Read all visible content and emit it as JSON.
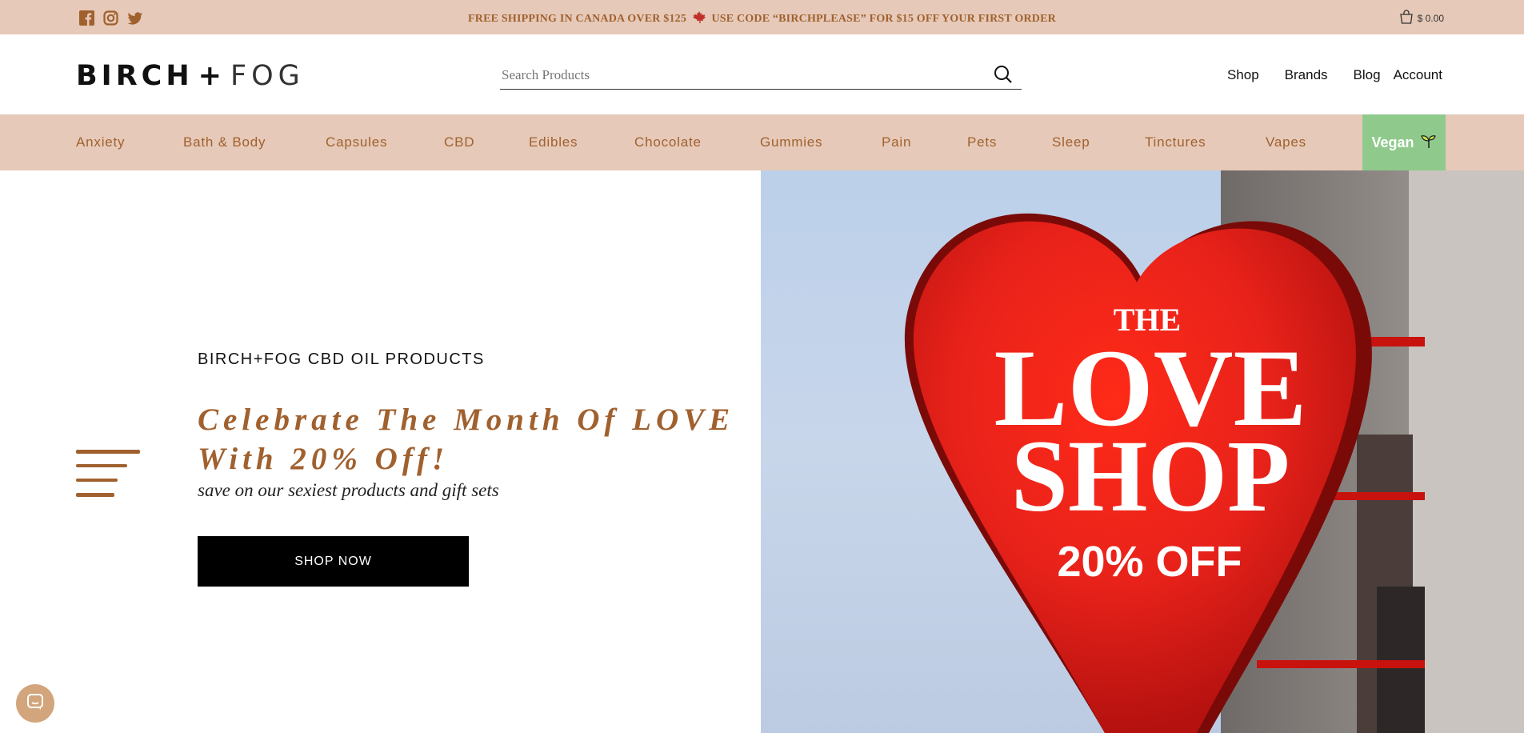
{
  "topbar": {
    "promo_text_1": "FREE SHIPPING IN CANADA OVER $125",
    "promo_text_2": "USE CODE “BIRCHPLEASE” FOR $15 OFF YOUR FIRST ORDER",
    "social_icons": [
      "facebook-icon",
      "instagram-icon",
      "twitter-icon"
    ],
    "cart_amount": "$ 0.00"
  },
  "header": {
    "logo_bold": "BIRCH",
    "logo_plus": "+",
    "logo_light": "FOG",
    "search_placeholder": "Search Products",
    "nav": [
      "Shop",
      "Brands",
      "Blog",
      "Account"
    ]
  },
  "categories": [
    "Anxiety",
    "Bath & Body",
    "Capsules",
    "CBD",
    "Edibles",
    "Chocolate",
    "Gummies",
    "Pain",
    "Pets",
    "Sleep",
    "Tinctures",
    "Vapes"
  ],
  "vegan_label": "Vegan",
  "hero": {
    "eyebrow": "BIRCH+FOG CBD OIL PRODUCTS",
    "headline_line1": "Celebrate The Month Of LOVE",
    "headline_line2": "With 20% Off!",
    "subheadline": "save on our sexiest products and gift sets",
    "cta": "SHOP NOW",
    "image_text_the": "THE",
    "image_text_love": "LOVE",
    "image_text_shop": "SHOP",
    "image_text_off": "20% OFF"
  },
  "colors": {
    "accent_bar": "#e6c9b8",
    "accent_text": "#a0612f",
    "vegan_bg": "#8fca8c",
    "heart_red": "#e8221a"
  }
}
